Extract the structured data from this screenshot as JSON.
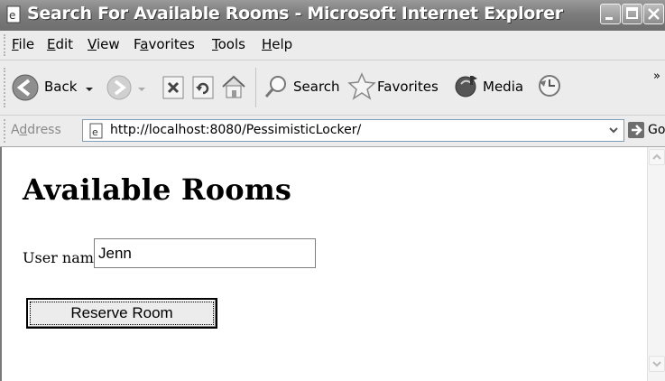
{
  "window": {
    "title": "Search For Available Rooms - Microsoft Internet Explorer",
    "icon": "ie-page-icon",
    "controls": [
      "minimize-icon",
      "maximize-icon",
      "close-icon"
    ]
  },
  "menu": {
    "items": [
      {
        "label": "File",
        "accel": "F"
      },
      {
        "label": "Edit",
        "accel": "E"
      },
      {
        "label": "View",
        "accel": "V"
      },
      {
        "label": "Favorites",
        "accel": "a"
      },
      {
        "label": "Tools",
        "accel": "T"
      },
      {
        "label": "Help",
        "accel": "H"
      }
    ]
  },
  "toolbar": {
    "back_label": "Back",
    "search_label": "Search",
    "favorites_label": "Favorites",
    "media_label": "Media",
    "overflow": "»"
  },
  "address": {
    "label": "Address",
    "url": "http://localhost:8080/PessimisticLocker/",
    "go_label": "Go"
  },
  "page": {
    "heading": "Available Rooms",
    "user_label": "User name:",
    "user_value": "Jenn",
    "reserve_button": "Reserve Room"
  }
}
